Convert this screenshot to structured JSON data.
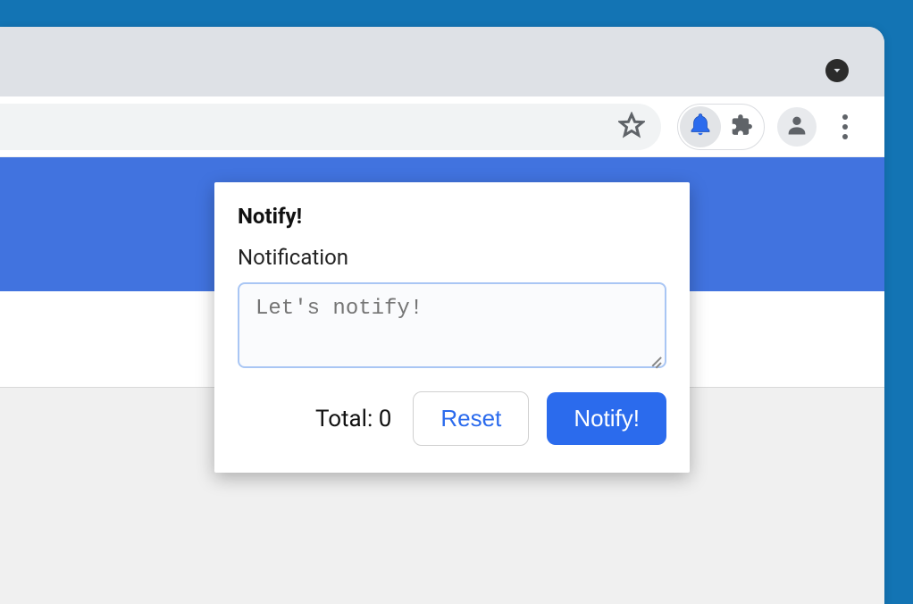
{
  "toolbar": {
    "icons": {
      "star": "star-icon",
      "bell": "bell-icon",
      "puzzle": "puzzle-icon",
      "avatar": "person-icon",
      "menu": "menu-icon",
      "dropdown": "chevron-down-icon"
    }
  },
  "popup": {
    "title": "Notify!",
    "field_label": "Notification",
    "textarea_placeholder": "Let's notify!",
    "textarea_value": "",
    "total_prefix": "Total: ",
    "total_value": 0,
    "reset_label": "Reset",
    "notify_label": "Notify!"
  },
  "colors": {
    "frame": "#1374b4",
    "hero": "#4173df",
    "primary": "#2b6bed"
  }
}
